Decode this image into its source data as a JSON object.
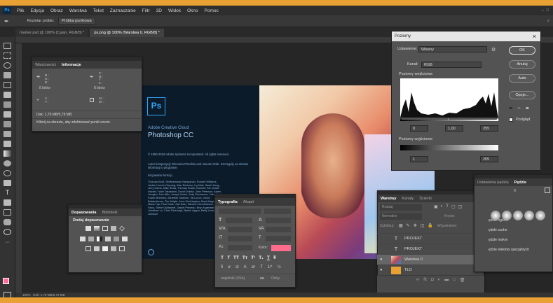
{
  "menu": [
    "Plik",
    "Edycja",
    "Obraz",
    "Warstwa",
    "Tekst",
    "Zaznaczanie",
    "Filtr",
    "3D",
    "Widok",
    "Okno",
    "Pomoc"
  ],
  "options": {
    "sample_size_label": "Rozmiar próbki:",
    "sample_size_value": "Próbka punktowa"
  },
  "doc_tabs": [
    "marker.psd @ 100% (Cyjan, RGB/8) *",
    "ps.png @ 100% (Warstwa 0, RGB/8) *"
  ],
  "info_panel": {
    "tabs": [
      "Właściwości",
      "Informacje"
    ],
    "r": "R :",
    "g": "G :",
    "b": "B :",
    "bits1": "8 bitów",
    "c": "C :",
    "m": "M :",
    "y": "Y :",
    "k": "K :",
    "bits2": "8 bitów",
    "x": "X :",
    "yy": "Y :",
    "w": "Sz :",
    "h": "W :",
    "doc": "Dok: 1,70 MB/5,79 MB",
    "hint": "Kliknij na obrazie, aby zdefiniować punkt czerni."
  },
  "splash": {
    "logo": "Ps",
    "brand": "Adobe Creative Cloud",
    "product": "Photoshop CC",
    "copyright": "© 1990-2018 Adobe Systems Incorporated. All rights reserved.",
    "artwork": "Autor kompozycji: Eleonora Plondzia and Janusz Szak. Szczegóły na ekranie informacji o programie.",
    "init": "Inicjowanie funkcji...",
    "credits": "Thomas Knoll, Seetharaman Narayanan, Russell Williams, Jackie Lincoln-Owyang, Alan Erickson, Ivy Mak, Sarah Kong, Jerry Harris, Mike Shaw, Thomas Ruark, Dominic Pat, David Hackel, Yukie Takahashi, David Dobish, John Peterson, Adam Jerugim, Tom Attix, Joseph Hsieh, Judy Severance, Yuko Kagita, Foster Brereton, Meredith Stotzner, Tai Luxon, Vinod Balakrishnan, Tim Wright, John Worthington, Mark Maguire, Maria Yap, Pam Clark, Joel Baer, Winston Hendrickson, Pete Falco, Steve Guilhamet, Daniel Presedo, Bryn Aspestrand, Jonathan Lo, Chris Steenwyk, Barkin Aygun, Betty Leong, Jaime Jonsson"
  },
  "adjust_panel": {
    "tabs": [
      "Dopasowania",
      "Biblioteki"
    ],
    "title": "Dodaj dopasowanie"
  },
  "typo_panel": {
    "tabs": [
      "Typografia",
      "Akapit"
    ],
    "color_label": "Kolor:",
    "lang": "angielski (USA)",
    "aa": "Ostry",
    "aa_icon": "aa"
  },
  "levels": {
    "title": "Poziomy",
    "preset_label": "Ustawienie:",
    "preset": "Własny",
    "channel_label": "Kanał:",
    "channel": "RGB",
    "input_label": "Poziomy wejściowe:",
    "in_black": "0",
    "in_mid": "1,00",
    "in_white": "255",
    "output_label": "Poziomy wyjściowe:",
    "out_black": "1",
    "out_white": "255",
    "ok": "OK",
    "cancel": "Anuluj",
    "auto": "Auto",
    "options": "Opcje...",
    "preview": "Podgląd",
    "close": "×"
  },
  "layers": {
    "tabs": [
      "Warstwy",
      "Kanały",
      "Ścieżki"
    ],
    "kind": "Rodzaj",
    "mode": "Normalne",
    "opacity_label": "Krycie:",
    "lock_label": "Zablokuj:",
    "fill_label": "Wypełnienie:",
    "items": [
      {
        "name": "PROJEKT",
        "type": "text"
      },
      {
        "name": "PROJEKT",
        "type": "text"
      },
      {
        "name": "Warstwa 0",
        "type": "image"
      },
      {
        "name": "TŁO",
        "type": "fill"
      }
    ]
  },
  "brush_panel": {
    "tabs": [
      "Ustawienia pędzla",
      "Pędzle"
    ],
    "size": "0",
    "groups": [
      "ędzle ogólne",
      "ędzle suche",
      "ędzle mokre",
      "ędzle efektów specjalnych"
    ]
  },
  "status": {
    "zoom": "100%",
    "doc": "Dok: 1,70 MB/5,79 MB"
  },
  "colors": {
    "accent": "#31a8ff",
    "swatch_fg": "#ff6b9a",
    "typo_color": "#ff6b8a"
  }
}
